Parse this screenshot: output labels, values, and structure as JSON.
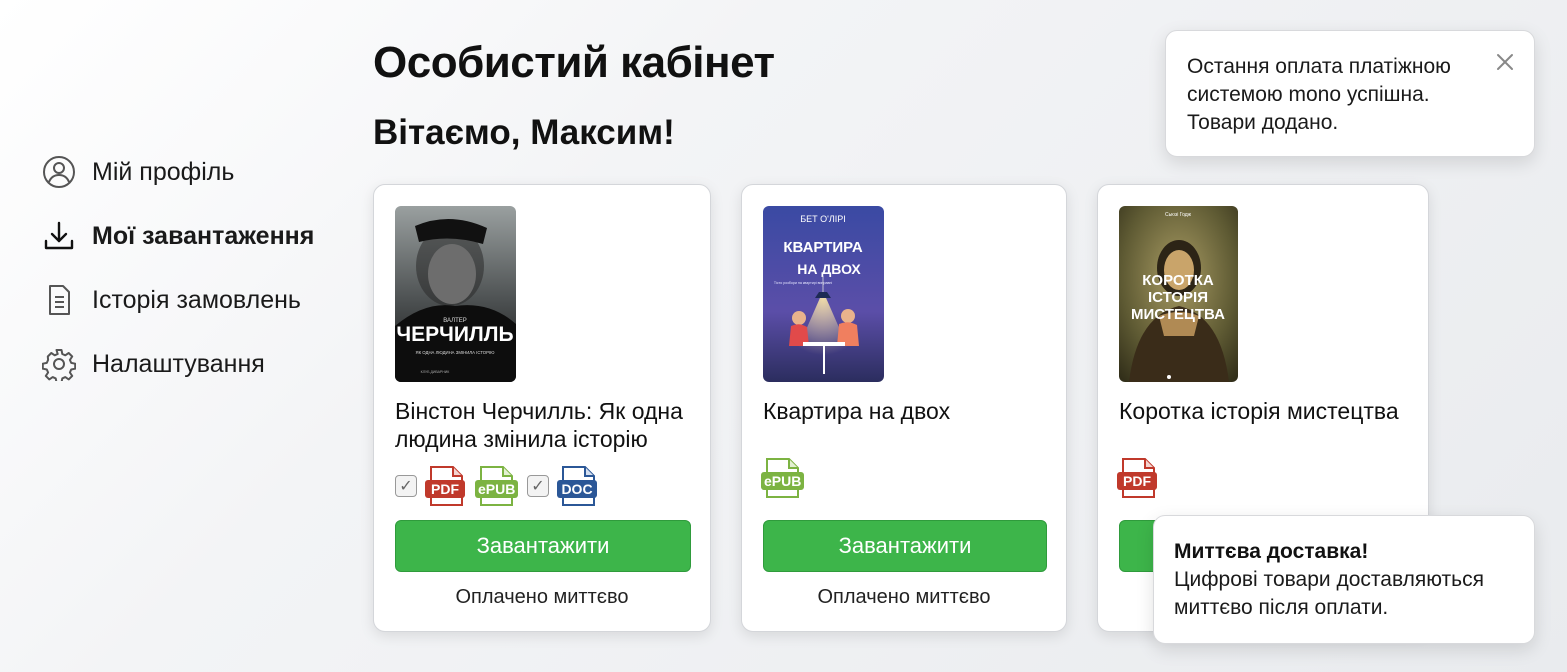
{
  "page": {
    "title": "Особистий кабінет",
    "greeting": "Вітаємо, Максим!"
  },
  "sidebar": {
    "items": [
      {
        "label": "Мій профіль",
        "icon": "user-circle-icon",
        "active": false
      },
      {
        "label": "Мої завантаження",
        "icon": "download-icon",
        "active": true
      },
      {
        "label": "Історія замовлень",
        "icon": "document-icon",
        "active": false
      },
      {
        "label": "Налаштування",
        "icon": "gear-icon",
        "active": false
      }
    ]
  },
  "books": [
    {
      "title": "Вінстон Черчилль: Як одна людина змінила історію",
      "cover": {
        "author": "ВАЛТЕР",
        "title": "ЧЕРЧИЛЛЬ",
        "subtitle": "ЯК ОДНА ЛЮДИНА ЗМІНИЛА ІСТОРІЮ",
        "publisher": "КЛУБ ДИВАРНИК",
        "colors": [
          "#8b9090",
          "#161616"
        ]
      },
      "formats": [
        {
          "type": "checkbox",
          "checked": true
        },
        {
          "type": "file",
          "label": "PDF",
          "color": "#c0392b"
        },
        {
          "type": "file",
          "label": "ePUB",
          "color": "#7cb342"
        },
        {
          "type": "checkbox",
          "checked": true
        },
        {
          "type": "file",
          "label": "DOC",
          "color": "#2b5797"
        }
      ],
      "button_label": "Завантажити",
      "status": "Оплачено миттєво"
    },
    {
      "title": "Квартира на двох",
      "cover": {
        "author": "БЕТ О'ЛІРІ",
        "title": "КВАРТИРА",
        "title2": "НА ДВОХ",
        "tagline": "Тісто розбори на квартирі виправні",
        "colors": [
          "#3b4fa6",
          "#7a5ba8"
        ]
      },
      "formats": [
        {
          "type": "file",
          "label": "ePUB",
          "color": "#7cb342"
        }
      ],
      "button_label": "Завантажити",
      "status": "Оплачено миттєво"
    },
    {
      "title": "Коротка історія мистецтва",
      "cover": {
        "author": "Сьюзі Годж",
        "title_lines": [
          "КОРОТКА",
          "ІСТОРІЯ",
          "МИСТЕЦТВА"
        ],
        "colors": [
          "#6f6a3c",
          "#2e2a17"
        ]
      },
      "formats": [
        {
          "type": "file",
          "label": "PDF",
          "color": "#c0392b"
        }
      ],
      "button_label": "Завантажити",
      "status": ""
    }
  ],
  "toasts": {
    "payment": {
      "message": "Остання оплата платіжною системою mono успішна. Товари додано."
    },
    "delivery": {
      "title": "Миттєва доставка!",
      "body": "Цифрові товари доставляються миттєво після оплати."
    }
  },
  "colors": {
    "accent": "#3db54a",
    "pdf": "#c0392b",
    "epub": "#7cb342",
    "doc": "#2b5797"
  }
}
